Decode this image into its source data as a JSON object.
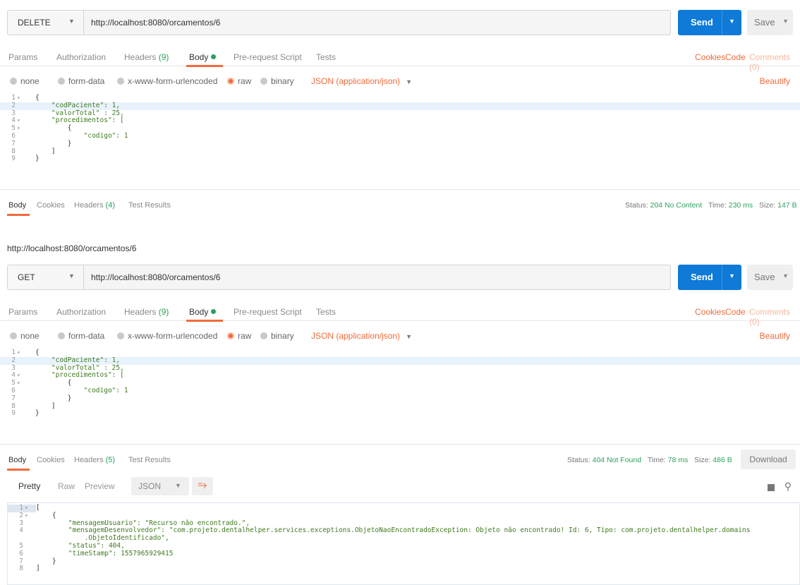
{
  "panel1": {
    "method": "DELETE",
    "url": "http://localhost:8080/orcamentos/6",
    "send": "Send",
    "save": "Save",
    "tabs": {
      "params": "Params",
      "authorization": "Authorization",
      "headers": "Headers",
      "headers_count": "(9)",
      "body": "Body",
      "prerequest": "Pre-request Script",
      "tests": "Tests"
    },
    "right_links": {
      "cookies": "Cookies",
      "code": "Code",
      "comments": "Comments (0)"
    },
    "body_types": {
      "none": "none",
      "formdata": "form-data",
      "urlencoded": "x-www-form-urlencoded",
      "raw": "raw",
      "binary": "binary",
      "json": "JSON (application/json)",
      "beautify": "Beautify"
    },
    "code": [
      "{",
      "    \"codPaciente\": 1,",
      "    \"valorTotal\" : 25,",
      "    \"procedimentos\": [",
      "        {",
      "            \"codigo\": 1",
      "        }",
      "    ]",
      "}"
    ],
    "response": {
      "tabs": {
        "body": "Body",
        "cookies": "Cookies",
        "headers": "Headers",
        "headers_count": "(4)",
        "tests": "Test Results"
      },
      "status_label": "Status:",
      "status_value": "204 No Content",
      "time_label": "Time:",
      "time_value": "230 ms",
      "size_label": "Size:",
      "size_value": "147 B"
    }
  },
  "panel2": {
    "title": "http://localhost:8080/orcamentos/6",
    "method": "GET",
    "url": "http://localhost:8080/orcamentos/6",
    "send": "Send",
    "save": "Save",
    "tabs": {
      "params": "Params",
      "authorization": "Authorization",
      "headers": "Headers",
      "headers_count": "(9)",
      "body": "Body",
      "prerequest": "Pre-request Script",
      "tests": "Tests"
    },
    "right_links": {
      "cookies": "Cookies",
      "code": "Code",
      "comments": "Comments (0)"
    },
    "body_types": {
      "none": "none",
      "formdata": "form-data",
      "urlencoded": "x-www-form-urlencoded",
      "raw": "raw",
      "binary": "binary",
      "json": "JSON (application/json)",
      "beautify": "Beautify"
    },
    "code": [
      "{",
      "    \"codPaciente\": 1,",
      "    \"valorTotal\" : 25,",
      "    \"procedimentos\": [",
      "        {",
      "            \"codigo\": 1",
      "        }",
      "    ]",
      "}"
    ],
    "response": {
      "tabs": {
        "body": "Body",
        "cookies": "Cookies",
        "headers": "Headers",
        "headers_count": "(5)",
        "tests": "Test Results"
      },
      "status_label": "Status:",
      "status_value": "404 Not Found",
      "time_label": "Time:",
      "time_value": "78 ms",
      "size_label": "Size:",
      "size_value": "486 B",
      "download": "Download",
      "view": {
        "pretty": "Pretty",
        "raw": "Raw",
        "preview": "Preview",
        "format": "JSON"
      },
      "code": [
        "[",
        "    {",
        "        \"mensagemUsuario\": \"Recurso não encontrado.\",",
        "        \"mensagemDesenvolvedor\": \"com.projeto.dentalhelper.services.exceptions.ObjetoNaoEncontradoException: Objeto não encontrado! Id: 6, Tipo: com.projeto.dentalhelper.domains",
        "            .ObjetoIdentificado\",",
        "        \"status\": 404,",
        "        \"timeStamp\": 1557965929415",
        "    }",
        "]"
      ],
      "line_numbers": [
        "1",
        "2",
        "3",
        "4",
        "",
        "5",
        "6",
        "7",
        "8"
      ]
    }
  },
  "icons": {
    "caret": "chevron-down-icon",
    "wrap": "wrap-icon",
    "copy": "copy-icon",
    "search": "search-icon"
  }
}
